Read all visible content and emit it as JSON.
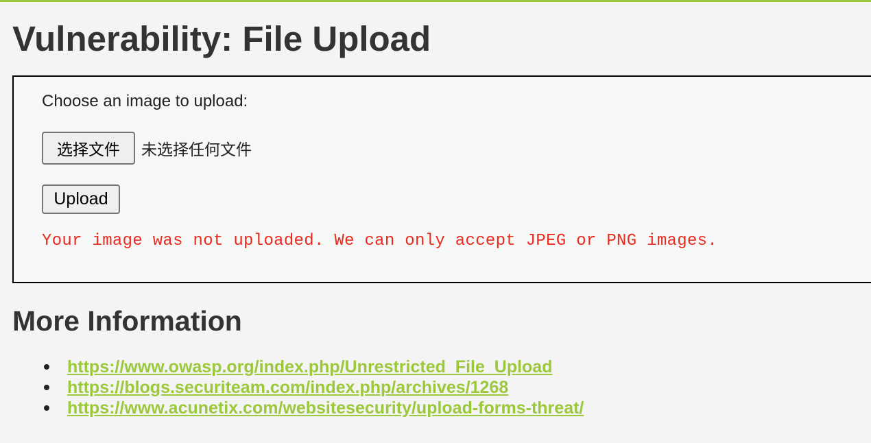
{
  "page_title": "Vulnerability: File Upload",
  "upload_form": {
    "prompt": "Choose an image to upload:",
    "choose_file_button": "选择文件",
    "file_status": "未选择任何文件",
    "upload_button": "Upload",
    "error_message": "Your image was not uploaded. We can only accept JPEG or PNG images."
  },
  "more_info": {
    "heading": "More Information",
    "links": [
      "https://www.owasp.org/index.php/Unrestricted_File_Upload",
      "https://blogs.securiteam.com/index.php/archives/1268",
      "https://www.acunetix.com/websitesecurity/upload-forms-threat/"
    ]
  },
  "colors": {
    "accent": "#9bc93b",
    "error": "#ea2b1f",
    "background": "#f4f4f4",
    "text": "#333333"
  }
}
